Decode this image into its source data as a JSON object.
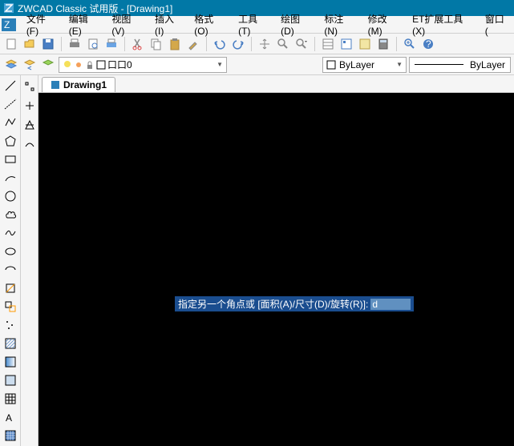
{
  "title": "ZWCAD Classic 试用版 - [Drawing1]",
  "menu": {
    "file": "文件(F)",
    "edit": "编辑(E)",
    "view": "视图(V)",
    "insert": "插入(I)",
    "format": "格式(O)",
    "tools": "工具(T)",
    "draw": "绘图(D)",
    "dimension": "标注(N)",
    "modify": "修改(M)",
    "ettools": "ET扩展工具(X)",
    "window": "窗口("
  },
  "layer_combo": "口口0",
  "layer_name": "ByLayer",
  "linetype_name": "ByLayer",
  "doc_tab": "Drawing1",
  "prompt_text": "指定另一个角点或 [面积(A)/尺寸(D)/旋转(R)]: ",
  "prompt_input": "d",
  "colors": {
    "titlebar": "#0178a6",
    "canvas": "#000000",
    "prompt_bg": "#1a4d8f"
  }
}
